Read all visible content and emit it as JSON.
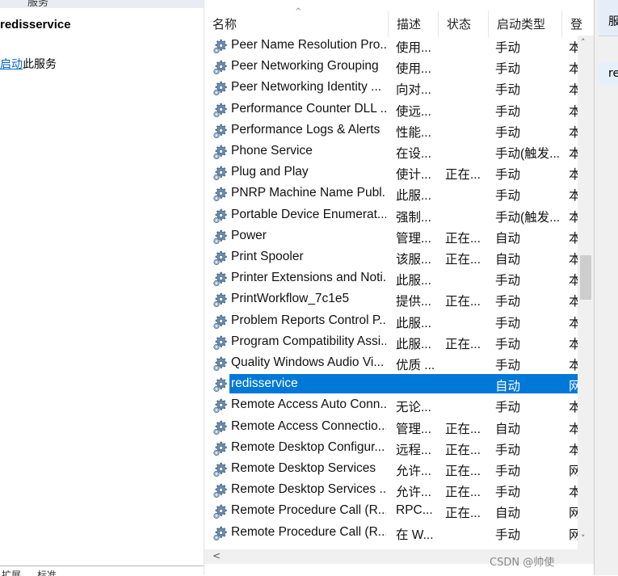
{
  "left": {
    "top_label": "服务",
    "service_title": "redisservice",
    "start_link": "启动",
    "start_suffix": "此服务",
    "bottom_tabs": [
      "扩展",
      "标准"
    ]
  },
  "header": {
    "sort_glyph": "^",
    "columns": [
      "名称",
      "描述",
      "状态",
      "启动类型",
      "登"
    ]
  },
  "rows": [
    {
      "name": "Peer Name Resolution Pro...",
      "desc": "使用...",
      "status": "",
      "start": "手动",
      "logon": "本"
    },
    {
      "name": "Peer Networking Grouping",
      "desc": "使用...",
      "status": "",
      "start": "手动",
      "logon": "本"
    },
    {
      "name": "Peer Networking Identity ...",
      "desc": "向对...",
      "status": "",
      "start": "手动",
      "logon": "本"
    },
    {
      "name": "Performance Counter DLL ...",
      "desc": "使远...",
      "status": "",
      "start": "手动",
      "logon": "本"
    },
    {
      "name": "Performance Logs & Alerts",
      "desc": "性能...",
      "status": "",
      "start": "手动",
      "logon": "本"
    },
    {
      "name": "Phone Service",
      "desc": "在设...",
      "status": "",
      "start": "手动(触发...",
      "logon": "本"
    },
    {
      "name": "Plug and Play",
      "desc": "使计...",
      "status": "正在...",
      "start": "手动",
      "logon": "本"
    },
    {
      "name": "PNRP Machine Name Publ...",
      "desc": "此服...",
      "status": "",
      "start": "手动",
      "logon": "本"
    },
    {
      "name": "Portable Device Enumerat...",
      "desc": "强制...",
      "status": "",
      "start": "手动(触发...",
      "logon": "本"
    },
    {
      "name": "Power",
      "desc": "管理...",
      "status": "正在...",
      "start": "自动",
      "logon": "本"
    },
    {
      "name": "Print Spooler",
      "desc": "该服...",
      "status": "正在...",
      "start": "自动",
      "logon": "本"
    },
    {
      "name": "Printer Extensions and Noti...",
      "desc": "此服...",
      "status": "",
      "start": "手动",
      "logon": "本"
    },
    {
      "name": "PrintWorkflow_7c1e5",
      "desc": "提供...",
      "status": "正在...",
      "start": "手动",
      "logon": "本"
    },
    {
      "name": "Problem Reports Control P...",
      "desc": "此服...",
      "status": "",
      "start": "手动",
      "logon": "本"
    },
    {
      "name": "Program Compatibility Assi...",
      "desc": "此服...",
      "status": "正在...",
      "start": "手动",
      "logon": "本"
    },
    {
      "name": "Quality Windows Audio Vi...",
      "desc": "优质 ...",
      "status": "",
      "start": "手动",
      "logon": "本"
    },
    {
      "name": "redisservice",
      "desc": "",
      "status": "",
      "start": "自动",
      "logon": "网",
      "selected": true
    },
    {
      "name": "Remote Access Auto Conn...",
      "desc": "无论...",
      "status": "",
      "start": "手动",
      "logon": "本"
    },
    {
      "name": "Remote Access Connectio...",
      "desc": "管理...",
      "status": "正在...",
      "start": "自动",
      "logon": "本"
    },
    {
      "name": "Remote Desktop Configur...",
      "desc": "远程...",
      "status": "正在...",
      "start": "手动",
      "logon": "本"
    },
    {
      "name": "Remote Desktop Services",
      "desc": "允许...",
      "status": "正在...",
      "start": "手动",
      "logon": "网"
    },
    {
      "name": "Remote Desktop Services ...",
      "desc": "允许...",
      "status": "正在...",
      "start": "手动",
      "logon": "本"
    },
    {
      "name": "Remote Procedure Call (R...",
      "desc": "RPC...",
      "status": "正在...",
      "start": "自动",
      "logon": "网"
    },
    {
      "name": "Remote Procedure Call (R...",
      "desc": "在 W...",
      "status": "",
      "start": "手动",
      "logon": "网"
    }
  ],
  "right": {
    "header_text": "服",
    "item_text": "re"
  },
  "scroll": {
    "up": "˄",
    "down": "˅",
    "left": "<"
  },
  "watermark": "CSDN @帅使"
}
